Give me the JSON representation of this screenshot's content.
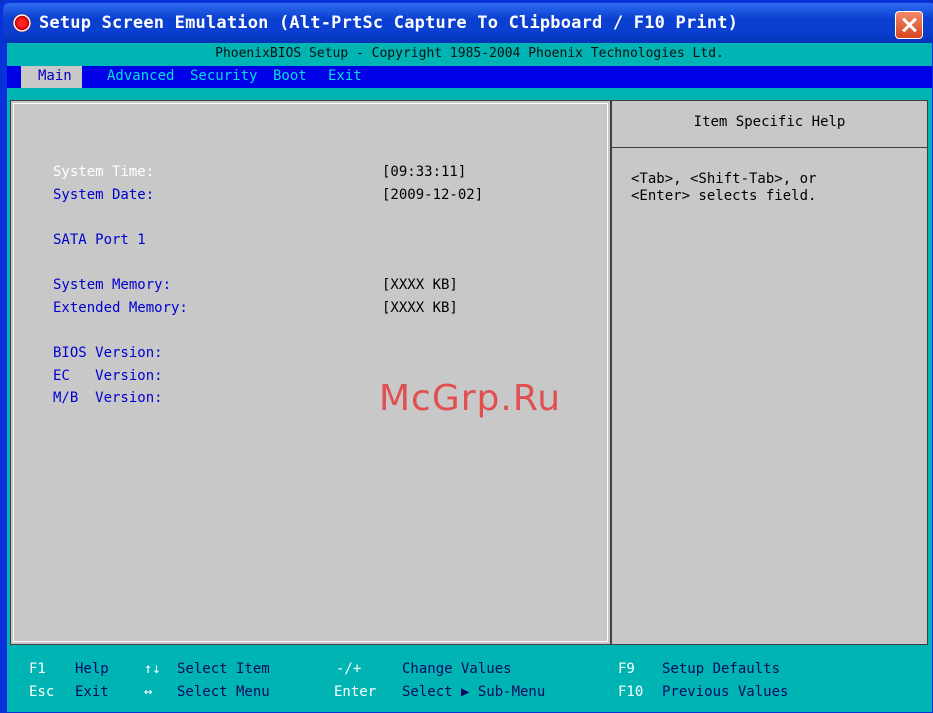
{
  "window": {
    "title": "Setup Screen Emulation (Alt-PrtSc Capture To Clipboard / F10 Print)",
    "app_icon": "bios-app-icon",
    "close_icon": "close-icon"
  },
  "header": {
    "copyright": "PhoenixBIOS Setup - Copyright 1985-2004 Phoenix Technologies Ltd."
  },
  "menu": {
    "items": [
      {
        "label": "Main",
        "active": true
      },
      {
        "label": "Advanced",
        "active": false
      },
      {
        "label": "Security",
        "active": false
      },
      {
        "label": "Boot",
        "active": false
      },
      {
        "label": "Exit",
        "active": false
      }
    ]
  },
  "main": {
    "fields": [
      {
        "label": "System Time:",
        "value": "[09:33:11]"
      },
      {
        "label": "System Date:",
        "value": "[2009-12-02]"
      },
      {
        "label": "SATA Port 1",
        "value": ""
      },
      {
        "label": "System Memory:",
        "value": "[XXXX KB]"
      },
      {
        "label": "Extended Memory:",
        "value": "[XXXX KB]"
      },
      {
        "label": "BIOS Version:",
        "value": ""
      },
      {
        "label": "EC   Version:",
        "value": ""
      },
      {
        "label": "M/B  Version:",
        "value": ""
      }
    ]
  },
  "help": {
    "title": "Item Specific Help",
    "line1": "<Tab>, <Shift-Tab>, or",
    "line2": "<Enter> selects field."
  },
  "watermark": "McGrp.Ru",
  "status": {
    "row1": [
      {
        "key": "F1",
        "desc": "Help"
      },
      {
        "key": "↑↓",
        "desc": "Select Item"
      },
      {
        "key": "-/+",
        "desc": "Change Values"
      },
      {
        "key": "F9",
        "desc": "Setup Defaults"
      }
    ],
    "row2": [
      {
        "key": "Esc",
        "desc": "Exit"
      },
      {
        "key": "↔",
        "desc": "Select Menu"
      },
      {
        "key": "Enter",
        "desc": "Select ▶ Sub-Menu"
      },
      {
        "key": "F10",
        "desc": "Previous Values"
      }
    ]
  },
  "colors": {
    "title_bar": "#0a3fd0",
    "menu_bar": "#0000e8",
    "panel": "#c8c8c8",
    "status_bar": "#00b4b4"
  }
}
